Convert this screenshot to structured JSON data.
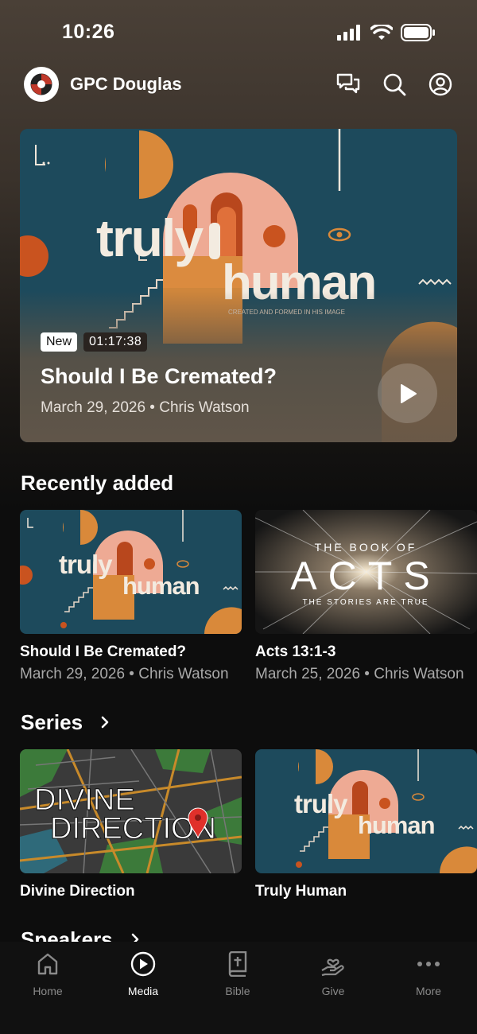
{
  "status_bar": {
    "time": "10:26"
  },
  "header": {
    "church_name": "GPC Douglas"
  },
  "hero": {
    "art_title_top": "truly",
    "art_title_bottom": "human",
    "art_tagline": "CREATED AND FORMED IN HIS IMAGE",
    "badge_new": "New",
    "duration": "01:17:38",
    "title": "Should I Be Cremated?",
    "meta": "March 29, 2026 • Chris Watson"
  },
  "recently_added": {
    "title": "Recently added",
    "items": [
      {
        "title": "Should I Be Cremated?",
        "meta": "March 29, 2026 • Chris Watson",
        "art_top": "truly",
        "art_bottom": "human"
      },
      {
        "title": "Acts 13:1-3",
        "meta": "March 25, 2026 • Chris Watson",
        "art_line1": "THE BOOK OF",
        "art_line2": "ACTS",
        "art_line3": "THE STORIES ARE TRUE"
      }
    ]
  },
  "series": {
    "title": "Series",
    "items": [
      {
        "title": "Divine Direction",
        "art_line1": "DIVINE",
        "art_line2": "DIRECTION"
      },
      {
        "title": "Truly Human",
        "art_top": "truly",
        "art_bottom": "human"
      }
    ]
  },
  "speakers": {
    "title": "Speakers"
  },
  "tabs": [
    {
      "label": "Home",
      "icon": "home-icon"
    },
    {
      "label": "Media",
      "icon": "play-circle-icon"
    },
    {
      "label": "Bible",
      "icon": "bible-icon"
    },
    {
      "label": "Give",
      "icon": "give-icon"
    },
    {
      "label": "More",
      "icon": "more-icon"
    }
  ],
  "colors": {
    "background": "#0d0d0d",
    "accent": "#ffffff",
    "art_teal": "#1d4a5c",
    "art_orange": "#d9893a",
    "art_pink": "#eeaa94"
  }
}
